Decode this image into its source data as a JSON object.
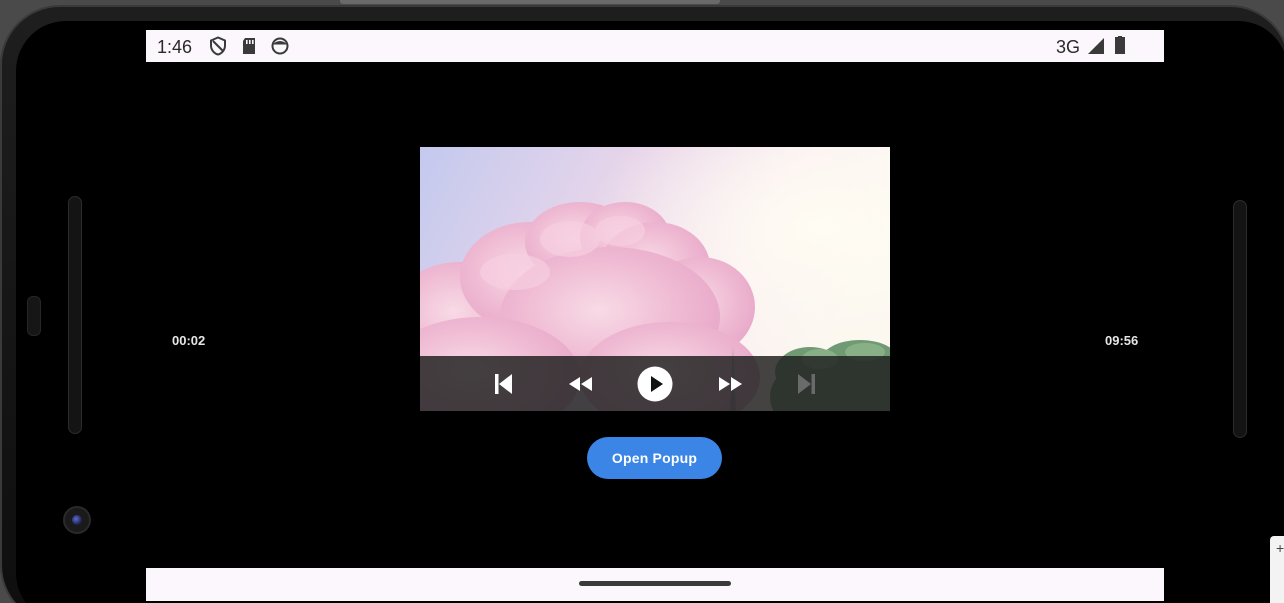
{
  "status_bar": {
    "time": "1:46",
    "network": "3G",
    "icons": [
      "shield-icon",
      "sd-card-icon",
      "face-icon",
      "signal-icon",
      "battery-icon"
    ]
  },
  "player": {
    "elapsed": "00:02",
    "remaining": "09:56",
    "controls": [
      "skip-previous-icon",
      "rewind-icon",
      "play-icon",
      "fast-forward-icon",
      "skip-next-icon"
    ],
    "next_disabled": true
  },
  "actions": {
    "open_popup_label": "Open Popup"
  },
  "colors": {
    "accent": "#3a85e6",
    "system_bar": "#fcf6fd",
    "background": "#000000"
  }
}
